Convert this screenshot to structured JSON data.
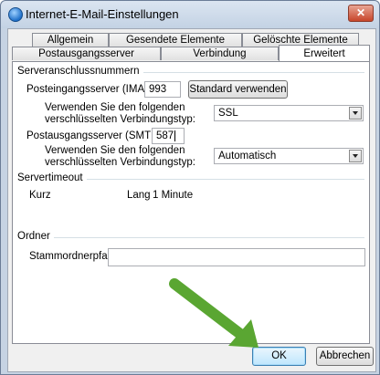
{
  "window": {
    "title": "Internet-E-Mail-Einstellungen",
    "close_symbol": "✕"
  },
  "tabs": {
    "row1": [
      "Allgemein",
      "Gesendete Elemente",
      "Gelöschte Elemente"
    ],
    "row2": [
      "Postausgangsserver",
      "Verbindung",
      "Erweitert"
    ],
    "active": "Erweitert"
  },
  "server_ports": {
    "group_title": "Serveranschlussnummern",
    "imap_label": "Posteingangsserver (IMAP):",
    "imap_value": "993",
    "default_button": "Standard verwenden",
    "imap_encryption_label_line1": "Verwenden Sie den folgenden",
    "imap_encryption_label_line2": "verschlüsselten Verbindungstyp:",
    "imap_encryption_value": "SSL",
    "smtp_label": "Postausgangsserver (SMTP):",
    "smtp_value": "587",
    "smtp_encryption_label_line1": "Verwenden Sie den folgenden",
    "smtp_encryption_label_line2": "verschlüsselten Verbindungstyp:",
    "smtp_encryption_value": "Automatisch"
  },
  "timeout": {
    "group_title": "Servertimeout",
    "short_label": "Kurz",
    "long_label": "Lang",
    "value_text": "1 Minute",
    "slider_fraction": 0.1
  },
  "folders": {
    "group_title": "Ordner",
    "root_path_label": "Stammordnerpfad:",
    "root_path_value": ""
  },
  "buttons": {
    "ok": "OK",
    "cancel": "Abbrechen"
  },
  "annotation": {
    "arrow_color": "#5aa632"
  }
}
